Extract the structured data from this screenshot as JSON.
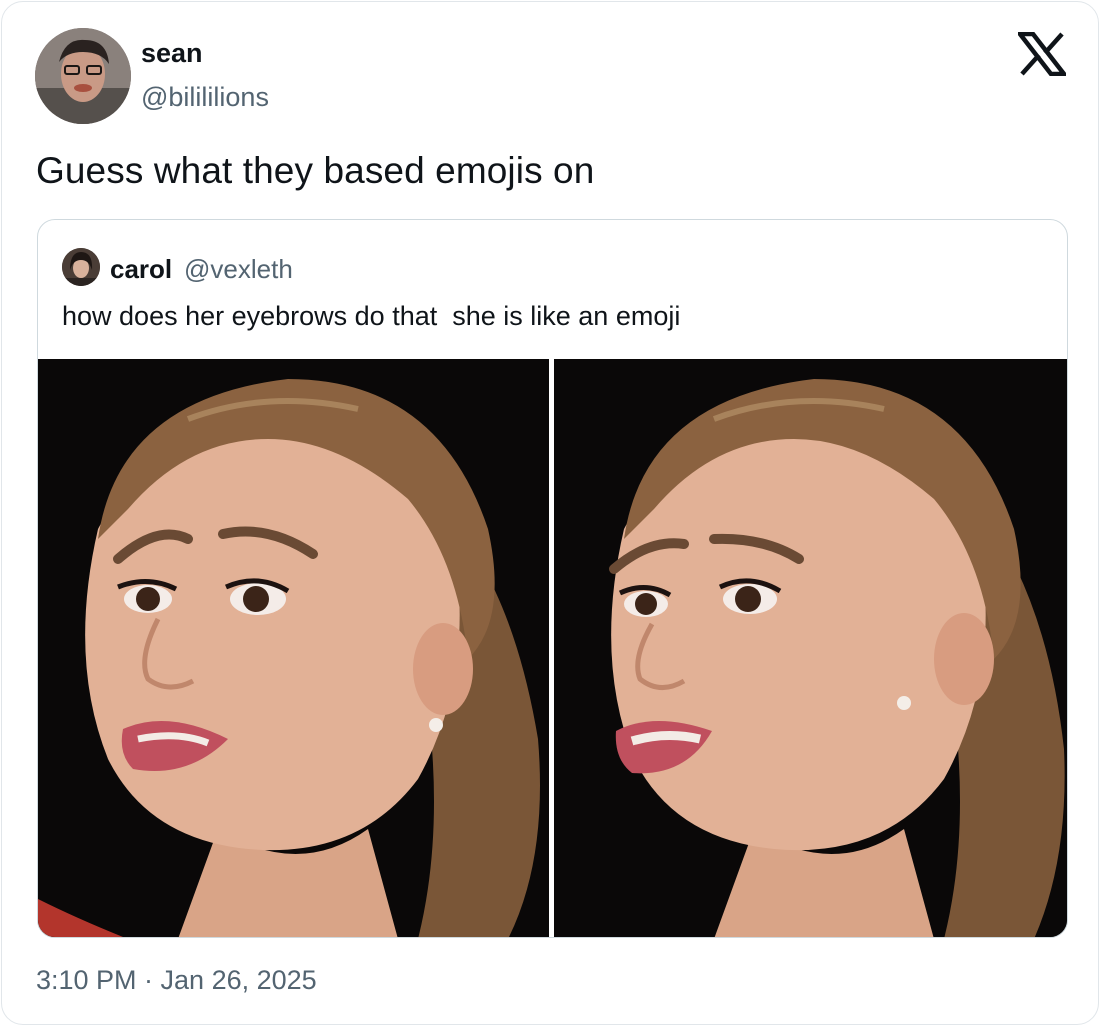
{
  "author": {
    "display_name": "sean",
    "handle": "@bilililions",
    "avatar_icon": "user-avatar-photo"
  },
  "platform_icon": "x-logo-icon",
  "tweet": {
    "text": "Guess what they based emojis on",
    "timestamp": "3:10 PM · Jan 26, 2025"
  },
  "quoted_tweet": {
    "display_name": "carol",
    "handle": "@vexleth",
    "text": "how does her eyebrows do that  she is like an emoji",
    "media": [
      {
        "icon": "photo-woman-concerned-expression-left"
      },
      {
        "icon": "photo-woman-concerned-expression-right"
      }
    ]
  },
  "colors": {
    "text_primary": "#0f1419",
    "text_secondary": "#536471",
    "border": "#cfd9de",
    "photo_background": "#0a0808"
  }
}
